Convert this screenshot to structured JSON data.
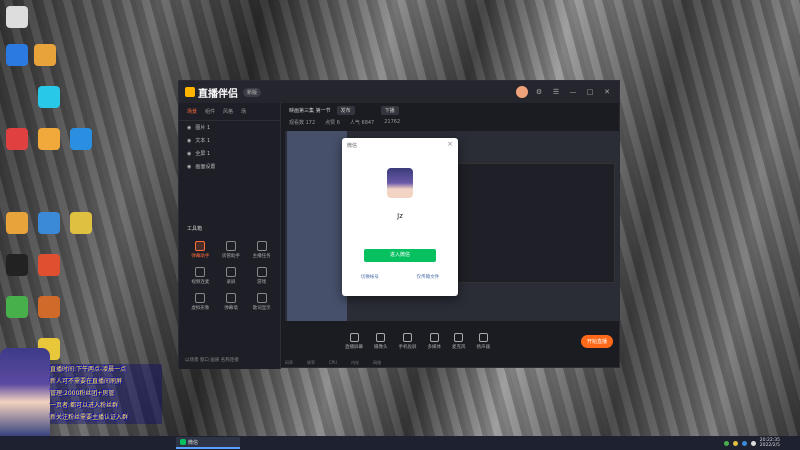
{
  "app": {
    "brand": "直播伴侣",
    "version_badge": "新版",
    "tabs": [
      "场景",
      "组件",
      "风格",
      "场"
    ],
    "sources": [
      "图片 1",
      "文本 1",
      "全屏 1",
      "画面设置"
    ],
    "tools_title": "工具箱",
    "tools": [
      "弹幕助手",
      "房管助手",
      "主播任务",
      "视频连麦",
      "录屏",
      "游戏",
      "虚拟形象",
      "弹幕墙",
      "歌词显示"
    ],
    "tip": "以场景 窗口 画质 名称连接",
    "header": {
      "title": "映画第三集 第一节",
      "btn1": "发布",
      "btn2": "下播",
      "stats": [
        "观看数 172",
        "点赞 6",
        "人气 6847",
        "21762"
      ]
    },
    "controls": [
      "直播屏幕",
      "摄像头",
      "手机投屏",
      "多媒体",
      "麦克风",
      "扬声器"
    ],
    "go_live": "开始直播",
    "status": [
      "码率",
      "帧率",
      "CPU",
      "内存",
      "网络"
    ]
  },
  "dialog": {
    "title": "微信",
    "name": "Jz",
    "login_button": "进入微信",
    "links": [
      "切换帐号",
      "仅传输文件"
    ]
  },
  "chat_overlay": {
    "lines": [
      "直播时间:下午两点-凌晨一点",
      "新人可不需要在直播间刷屏",
      "管理:2000粉丝团+房管",
      "一页者:都可以进入粉丝群",
      "新关注粉丝需要主播认证入群"
    ]
  },
  "taskbar": {
    "app_label": "微信",
    "time": "20:22:35",
    "date": "2022/2/5"
  },
  "colors": {
    "accent": "#ff6a1a",
    "wechat": "#07c160"
  }
}
